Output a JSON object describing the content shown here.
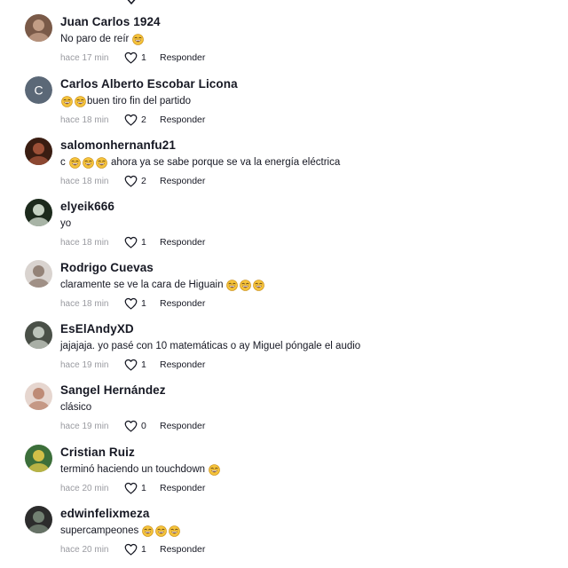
{
  "comments": [
    {
      "author": "Juan Carlos 1924",
      "text_before": "No paro de reír",
      "emojis_after": 1,
      "time": "hace 17 min",
      "likes": "1",
      "reply": "Responder",
      "avatar_colors": [
        "#7a5a48",
        "#caa48c"
      ]
    },
    {
      "author": "Carlos Alberto Escobar Licona",
      "text_before": "",
      "emojis_before": 2,
      "text_after": "buen tiro fin del partido",
      "time": "hace 18 min",
      "likes": "2",
      "reply": "Responder",
      "avatar_letter": "C",
      "avatar_colors": [
        "#5b6877",
        "#5b6877"
      ]
    },
    {
      "author": "salomonhernanfu21",
      "text_before": "c",
      "emojis_after": 3,
      "text_after": " ahora ya se sabe porque se va la energía eléctrica",
      "time": "hace 18 min",
      "likes": "2",
      "reply": "Responder",
      "avatar_colors": [
        "#3a1d12",
        "#a8563c"
      ]
    },
    {
      "author": "elyeik666",
      "text_before": "yo",
      "time": "hace 18 min",
      "likes": "1",
      "reply": "Responder",
      "avatar_colors": [
        "#1c2a1c",
        "#d7e3d4"
      ]
    },
    {
      "author": "Rodrigo Cuevas",
      "text_before": "claramente se ve la cara de Higuain",
      "emojis_after": 3,
      "time": "hace 18 min",
      "likes": "1",
      "reply": "Responder",
      "avatar_colors": [
        "#d9d3cf",
        "#8c7a6e"
      ]
    },
    {
      "author": "EsElAndyXD",
      "text_before": "jajajaja. yo pasé con 10 matemáticas o ay Miguel póngale el audio",
      "time": "hace 19 min",
      "likes": "1",
      "reply": "Responder",
      "avatar_colors": [
        "#4a5048",
        "#c9cfc6"
      ]
    },
    {
      "author": "Sangel Hernández",
      "text_before": "clásico",
      "time": "hace 19 min",
      "likes": "0",
      "reply": "Responder",
      "avatar_colors": [
        "#e6d6cf",
        "#b9836c"
      ]
    },
    {
      "author": "Cristian Ruiz",
      "text_before": "terminó haciendo un touchdown",
      "emojis_after": 1,
      "time": "hace 20 min",
      "likes": "1",
      "reply": "Responder",
      "avatar_colors": [
        "#3c6f3a",
        "#e2c94a"
      ]
    },
    {
      "author": "edwinfelixmeza",
      "text_before": "supercampeones",
      "emojis_after": 3,
      "time": "hace 20 min",
      "likes": "1",
      "reply": "Responder",
      "avatar_colors": [
        "#2c2c2c",
        "#7a8a7a"
      ]
    }
  ],
  "icons": {
    "like": "heart-outline-icon",
    "emoji": "laughing-face-emoji"
  },
  "colors": {
    "meta_gray": "#9a9ba1",
    "text": "#161823",
    "emoji_yellow": "#f5c33b"
  }
}
